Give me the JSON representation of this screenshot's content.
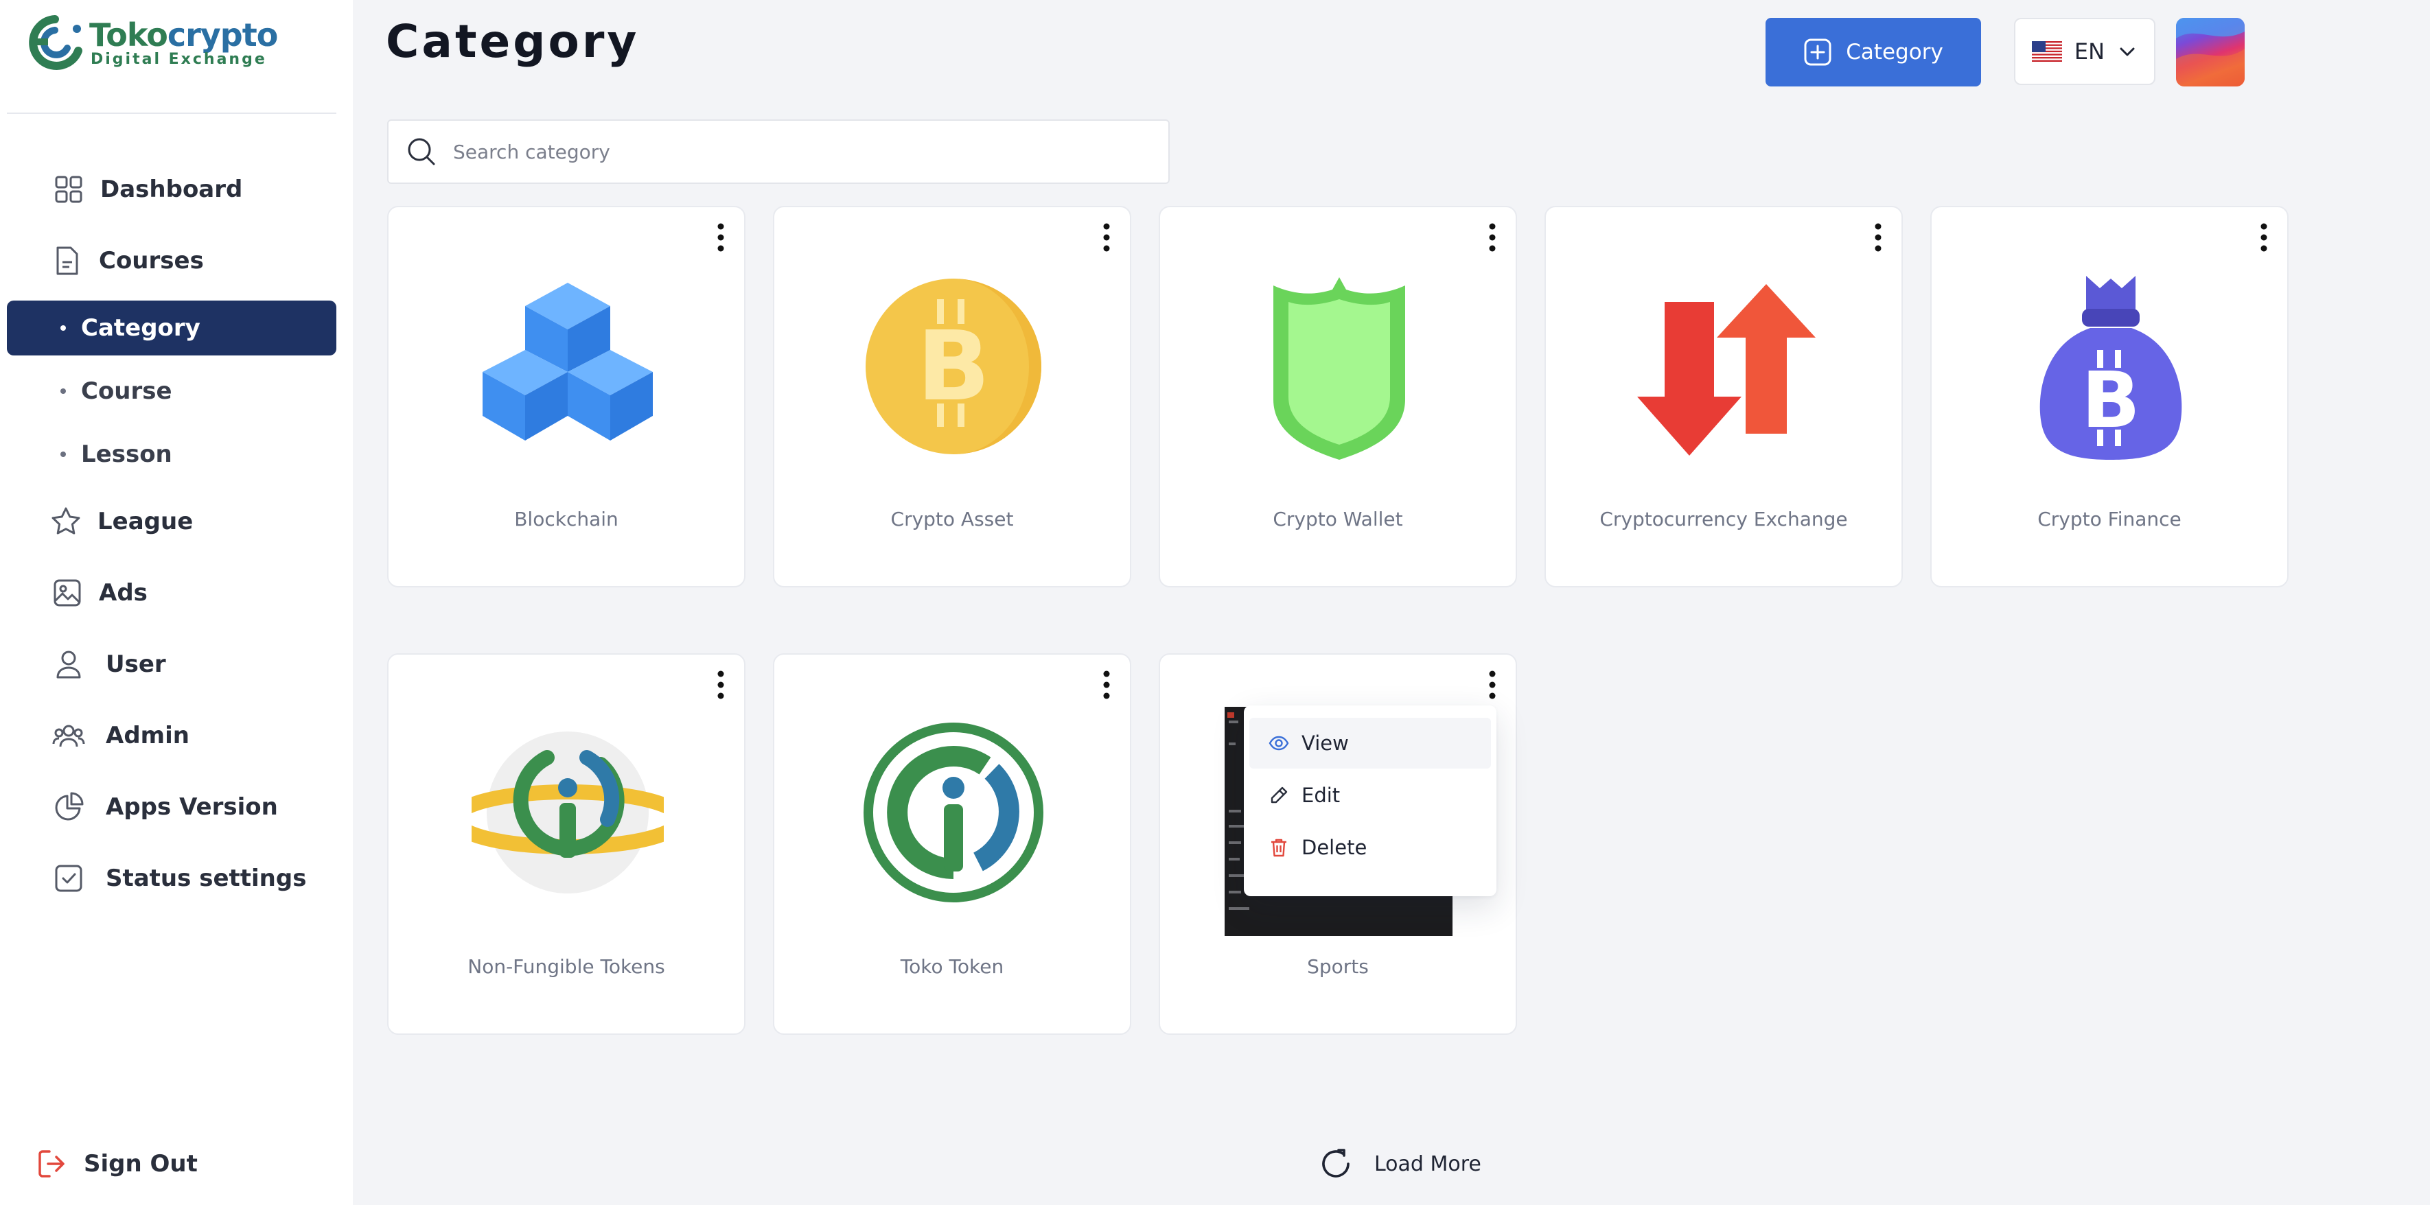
{
  "brand": {
    "name_part1": "Toko",
    "name_part2": "crypto",
    "tagline": "Digital Exchange"
  },
  "sidebar": {
    "items": [
      {
        "label": "Dashboard",
        "icon": "grid-icon"
      },
      {
        "label": "Courses",
        "icon": "document-icon"
      },
      {
        "label": "Category",
        "icon": "dot",
        "active": true
      },
      {
        "label": "Course",
        "icon": "dot"
      },
      {
        "label": "Lesson",
        "icon": "dot"
      },
      {
        "label": "League",
        "icon": "star-icon"
      },
      {
        "label": "Ads",
        "icon": "image-icon"
      },
      {
        "label": "User",
        "icon": "user-icon"
      },
      {
        "label": "Admin",
        "icon": "users-icon"
      },
      {
        "label": "Apps Version",
        "icon": "pie-chart-icon"
      },
      {
        "label": "Status settings",
        "icon": "check-square-icon"
      }
    ],
    "signout_label": "Sign Out"
  },
  "header": {
    "title": "Category",
    "add_button_label": "Category",
    "language_code": "EN"
  },
  "search": {
    "placeholder": "Search category",
    "value": ""
  },
  "categories": [
    {
      "name": "Blockchain",
      "icon": "cubes-icon"
    },
    {
      "name": "Crypto Asset",
      "icon": "bitcoin-coin-icon"
    },
    {
      "name": "Crypto Wallet",
      "icon": "shield-icon"
    },
    {
      "name": "Cryptocurrency Exchange",
      "icon": "exchange-arrows-icon"
    },
    {
      "name": "Crypto Finance",
      "icon": "bitcoin-bag-icon"
    },
    {
      "name": "Non-Fungible Tokens",
      "icon": "nft-planet-icon"
    },
    {
      "name": "Toko Token",
      "icon": "toko-token-icon"
    },
    {
      "name": "Sports",
      "icon": "terminal-screenshot-icon"
    }
  ],
  "context_menu": {
    "items": [
      {
        "label": "View",
        "icon": "eye-icon"
      },
      {
        "label": "Edit",
        "icon": "pencil-icon"
      },
      {
        "label": "Delete",
        "icon": "trash-icon"
      }
    ]
  },
  "load_more_label": "Load More",
  "colors": {
    "accent": "#3a6fd8",
    "nav_active": "#1e3263",
    "brand_green": "#2f7d53",
    "danger": "#e2483d"
  }
}
